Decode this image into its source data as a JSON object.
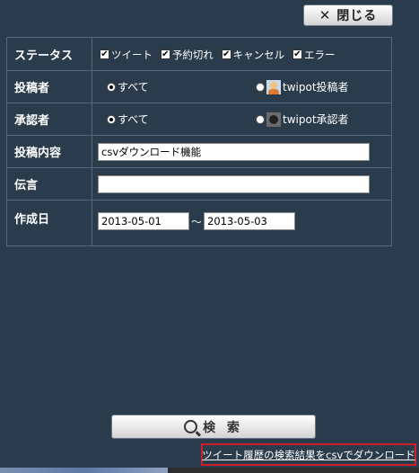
{
  "header": {
    "close_label": "閉じる",
    "close_icon": "✕"
  },
  "form": {
    "status": {
      "label": "ステータス",
      "options": [
        {
          "label": "ツイート",
          "checked": true
        },
        {
          "label": "予約切れ",
          "checked": true
        },
        {
          "label": "キャンセル",
          "checked": true
        },
        {
          "label": "エラー",
          "checked": true
        }
      ]
    },
    "poster": {
      "label": "投稿者",
      "options": [
        {
          "label": "すべて",
          "selected": true
        },
        {
          "label": "twipot投稿者",
          "selected": false
        }
      ]
    },
    "approver": {
      "label": "承認者",
      "options": [
        {
          "label": "すべて",
          "selected": true
        },
        {
          "label": "twipot承認者",
          "selected": false
        }
      ]
    },
    "content": {
      "label": "投稿内容",
      "value": "csvダウンロード機能"
    },
    "message": {
      "label": "伝言",
      "value": ""
    },
    "created": {
      "label": "作成日",
      "from": "2013-05-01",
      "separator": "～",
      "to": "2013-05-03"
    }
  },
  "actions": {
    "search_label": "検 索",
    "download_label": "ツイート履歴の検索結果をcsvでダウンロード"
  }
}
